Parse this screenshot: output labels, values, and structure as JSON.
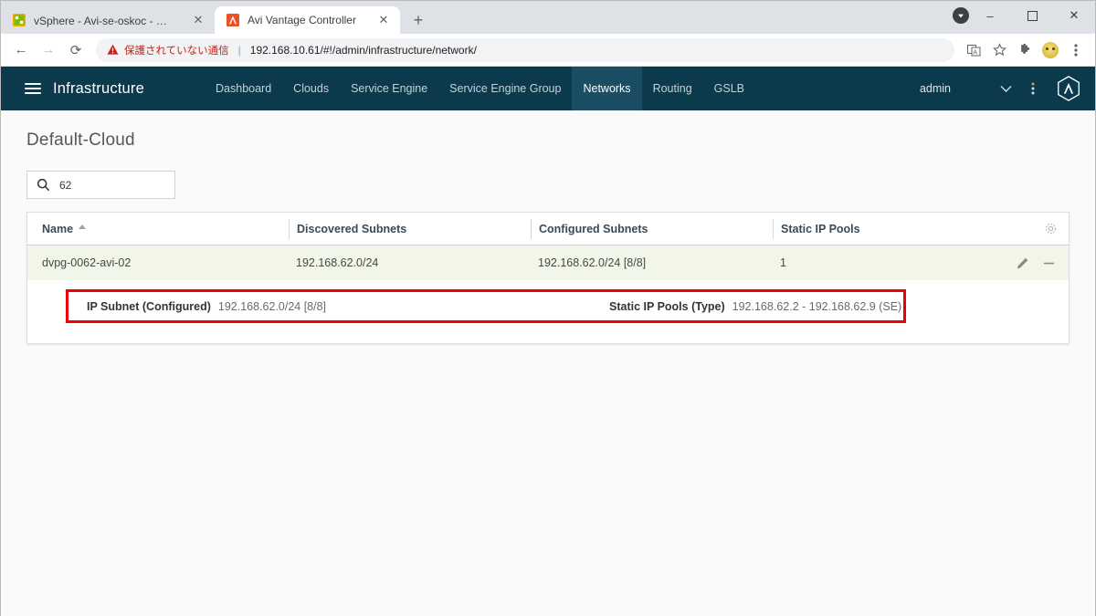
{
  "browser": {
    "tabs": [
      {
        "title": "vSphere - Avi-se-oskoc - サマリ",
        "favicon": "vsphere-icon",
        "active": false,
        "close_label": "✕"
      },
      {
        "title": "Avi Vantage Controller",
        "favicon": "avi-icon",
        "active": true,
        "close_label": "✕"
      }
    ],
    "new_tab_label": "+",
    "window_controls": {
      "minimize": "–",
      "maximize": "☐",
      "close": "✕"
    },
    "nav": {
      "back": "←",
      "forward": "→",
      "reload": "⟳"
    },
    "omnibox": {
      "security_text": "保護されていない通信",
      "separator": "|",
      "url": "192.168.10.61/#!/admin/infrastructure/network/",
      "warning_icon": "warning-triangle-icon"
    },
    "omnibox_actions": [
      "translate-icon",
      "bookmark-star-icon",
      "extensions-puzzle-icon",
      "profile-avatar",
      "browser-menu-icon"
    ]
  },
  "app_header": {
    "menu_icon": "hamburger-menu-icon",
    "title": "Infrastructure",
    "nav_items": [
      {
        "label": "Dashboard",
        "active": false
      },
      {
        "label": "Clouds",
        "active": false
      },
      {
        "label": "Service Engine",
        "active": false
      },
      {
        "label": "Service Engine Group",
        "active": false
      },
      {
        "label": "Networks",
        "active": true
      },
      {
        "label": "Routing",
        "active": false
      },
      {
        "label": "GSLB",
        "active": false
      }
    ],
    "user": "admin",
    "chevron_icon": "chevron-down-icon",
    "overflow_icon": "vertical-dots-icon",
    "logo_icon": "avi-hexagon-logo"
  },
  "page": {
    "title": "Default-Cloud",
    "search": {
      "value": "62",
      "placeholder": "",
      "icon": "search-icon"
    },
    "table": {
      "headers": [
        "Name",
        "Discovered Subnets",
        "Configured Subnets",
        "Static IP Pools"
      ],
      "sort_column": "Name",
      "sort_direction": "ascending",
      "settings_icon": "gear-icon",
      "rows": [
        {
          "name": "dvpg-0062-avi-02",
          "discovered_subnets": "192.168.62.0/24",
          "configured_subnets": "192.168.62.0/24 [8/8]",
          "static_ip_pools": "1",
          "edit_icon": "pencil-edit-icon",
          "delete_icon": "minus-remove-icon"
        }
      ],
      "detail": {
        "highlight_color": "#ee0000",
        "fields": [
          {
            "label": "IP Subnet (Configured)",
            "value": "192.168.62.0/24 [8/8]"
          },
          {
            "label": "Static IP Pools (Type)",
            "value": "192.168.62.2 - 192.168.62.9 (SE)"
          }
        ]
      }
    }
  },
  "colors": {
    "app_header_bg": "#0b3a4d",
    "nav_active_bg": "#1b4d63",
    "row_bg": "#f2f6e8",
    "annotation": "#ee0000",
    "not_secure": "#c5221f"
  }
}
